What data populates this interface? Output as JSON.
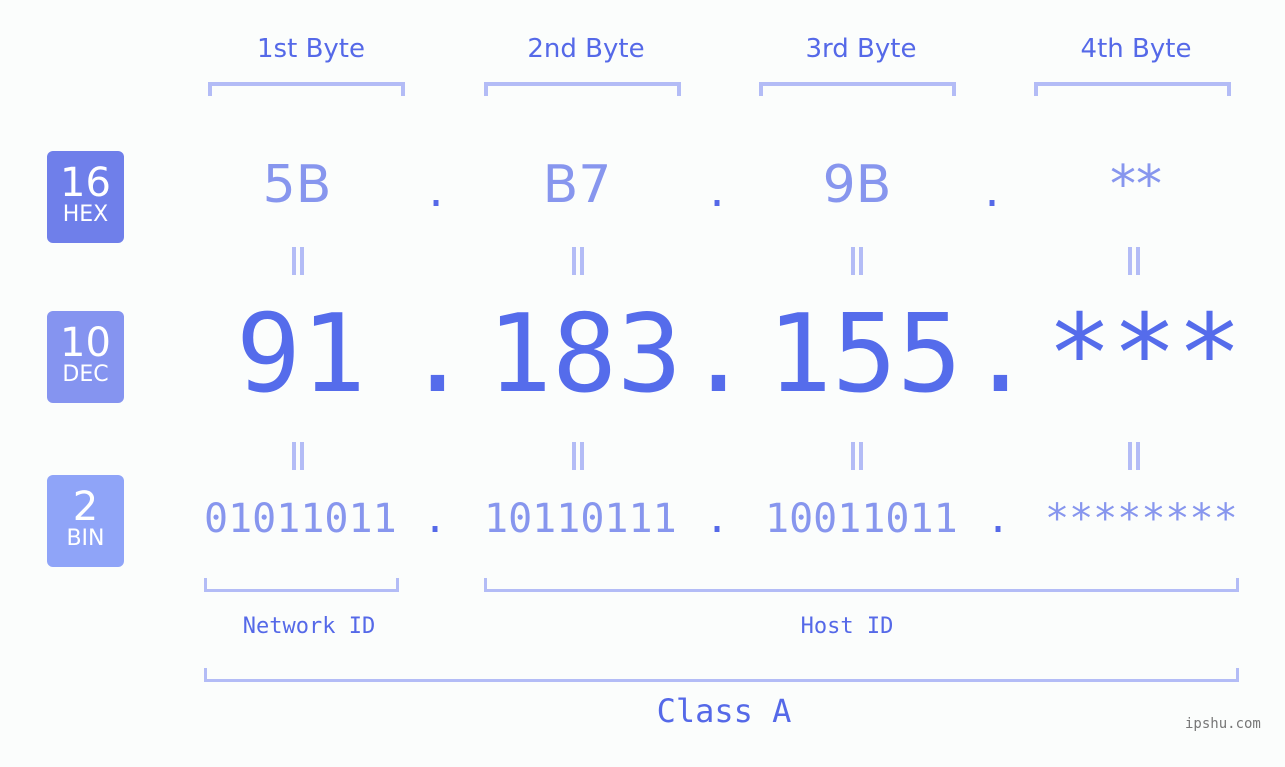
{
  "byte_headers": [
    "1st Byte",
    "2nd Byte",
    "3rd Byte",
    "4th Byte"
  ],
  "badges": [
    {
      "base": "16",
      "label": "HEX",
      "color": "#6f7fea"
    },
    {
      "base": "10",
      "label": "DEC",
      "color": "#8594f0"
    },
    {
      "base": "2",
      "label": "BIN",
      "color": "#8fa4f8"
    }
  ],
  "hex": [
    "5B",
    "B7",
    "9B",
    "**"
  ],
  "dec": [
    "91",
    "183",
    "155",
    "***"
  ],
  "bin": [
    "01011011",
    "10110111",
    "10011011",
    "********"
  ],
  "separator": ".",
  "labels": {
    "network_id": "Network ID",
    "host_id": "Host ID",
    "class": "Class A"
  },
  "watermark": "ipshu.com",
  "colors": {
    "accent": "#5569e8",
    "light": "#8796ee",
    "bracket": "#b3bcf6"
  }
}
